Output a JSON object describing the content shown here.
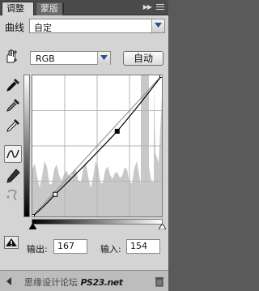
{
  "tabs": [
    {
      "label": "调整",
      "active": true
    },
    {
      "label": "蒙版",
      "active": false
    }
  ],
  "preset": {
    "label": "曲线",
    "value": "自定"
  },
  "channel": {
    "value": "RGB"
  },
  "auto_button": "自动",
  "curve": {
    "points": [
      [
        0,
        0
      ],
      [
        45,
        40
      ],
      [
        167,
        154
      ],
      [
        255,
        255
      ]
    ],
    "selected_point": 2
  },
  "io": {
    "output_label": "输出:",
    "output_value": "167",
    "input_label": "输入:",
    "input_value": "154"
  },
  "watermark": {
    "text": "思缘设计论坛",
    "site": "PS23.net"
  },
  "colors": {
    "panel": "#d4d4d4",
    "tabbar": "#4b4b4b",
    "histogram": "#c8c8c8"
  },
  "icons": [
    "hand-target-icon",
    "eyedropper-black-icon",
    "eyedropper-gray-icon",
    "eyedropper-white-icon",
    "curve-tool-icon",
    "pencil-icon",
    "smooth-icon",
    "clipping-warning-icon"
  ]
}
